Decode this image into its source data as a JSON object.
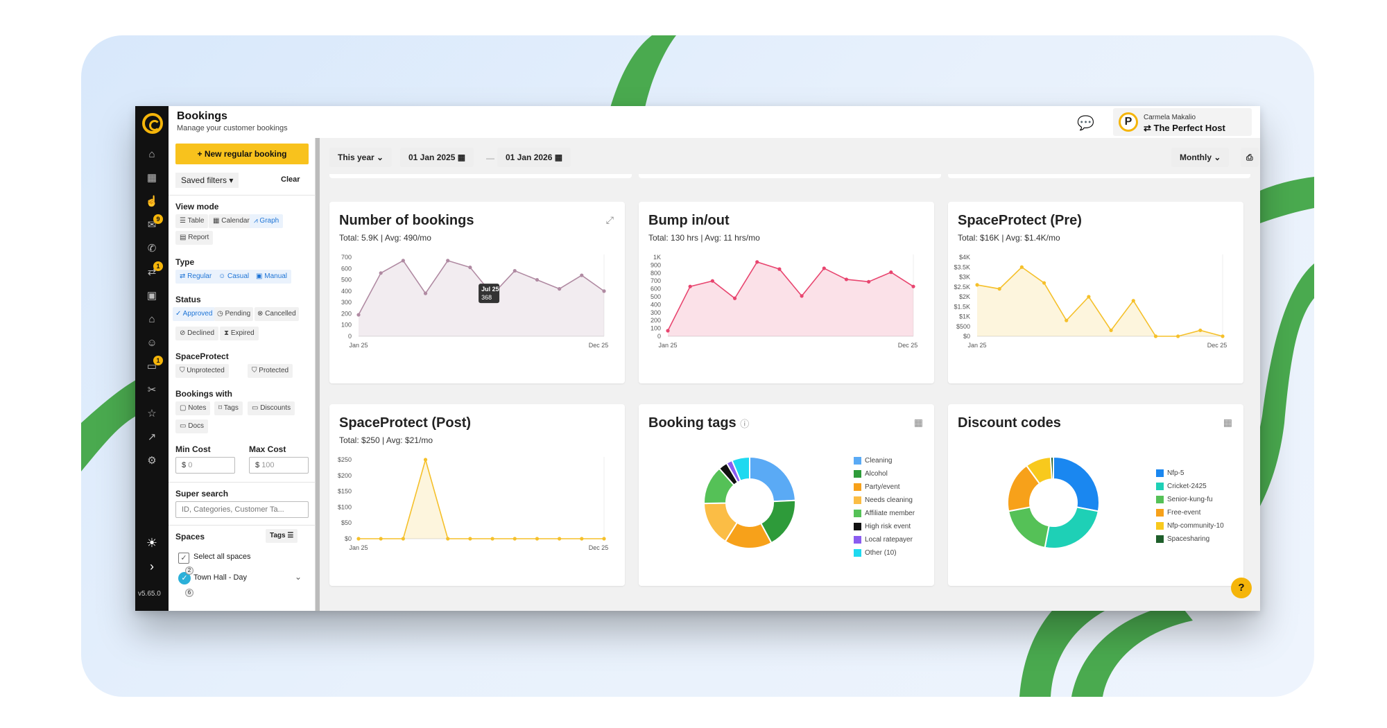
{
  "app": {
    "version": "v5.65.0"
  },
  "header": {
    "title": "Bookings",
    "subtitle": "Manage your customer bookings",
    "user_name": "Carmela Makalio",
    "org": "The Perfect Host",
    "avatar_letter": "P"
  },
  "sidebar": {
    "badges": [
      "9",
      "1",
      "1"
    ]
  },
  "filters": {
    "new_booking": "New regular booking",
    "saved_filters": "Saved filters",
    "clear": "Clear",
    "view_mode": {
      "label": "View mode",
      "options": [
        "Table",
        "Calendar",
        "Graph",
        "Report"
      ]
    },
    "type": {
      "label": "Type",
      "options": [
        "Regular",
        "Casual",
        "Manual"
      ]
    },
    "status": {
      "label": "Status",
      "options": [
        "Approved",
        "Pending",
        "Cancelled",
        "Declined",
        "Expired"
      ]
    },
    "spaceprotect": {
      "label": "SpaceProtect",
      "options": [
        "Unprotected",
        "Protected"
      ]
    },
    "bookings_with": {
      "label": "Bookings with",
      "options": [
        "Notes",
        "Tags",
        "Discounts",
        "Docs"
      ]
    },
    "min_cost": {
      "label": "Min Cost",
      "value": "0"
    },
    "max_cost": {
      "label": "Max Cost",
      "value": "100"
    },
    "currency": "$",
    "super_search": {
      "label": "Super search",
      "placeholder": "ID, Categories, Customer Ta..."
    },
    "spaces": {
      "label": "Spaces",
      "tags": "Tags",
      "select_all": "Select all spaces",
      "items": [
        {
          "name": "Town Hall - Day",
          "count": "2"
        },
        {
          "count": "6"
        }
      ]
    }
  },
  "toolbar": {
    "period": "This year",
    "date_from": "01 Jan 2025",
    "date_to": "01 Jan 2026",
    "interval": "Monthly"
  },
  "colors": {
    "accent": "#f8c21d",
    "link": "#1e74d6"
  },
  "chart_data": [
    {
      "type": "area",
      "title": "Number of bookings",
      "subtitle": "Total: 5.9K | Avg: 490/mo",
      "x": [
        "Jan 25",
        "Feb 25",
        "Mar 25",
        "Apr 25",
        "May 25",
        "Jun 25",
        "Jul 25",
        "Aug 25",
        "Sep 25",
        "Oct 25",
        "Nov 25",
        "Dec 25"
      ],
      "series": [
        {
          "values": [
            190,
            560,
            670,
            380,
            670,
            610,
            368,
            580,
            500,
            420,
            540,
            400
          ],
          "color": "#b08aa2"
        }
      ],
      "y_ticks": [
        "0",
        "100",
        "200",
        "300",
        "400",
        "500",
        "600",
        "700"
      ],
      "ylim": [
        0,
        700
      ],
      "x_tick_labels": [
        "Jan 25",
        "Dec 25"
      ],
      "tooltip": {
        "label": "Jul 25",
        "value": "368"
      }
    },
    {
      "type": "area",
      "title": "Bump in/out",
      "subtitle": "Total: 130 hrs | Avg: 11 hrs/mo",
      "x": [
        "Jan 25",
        "Feb 25",
        "Mar 25",
        "Apr 25",
        "May 25",
        "Jun 25",
        "Jul 25",
        "Aug 25",
        "Sep 25",
        "Oct 25",
        "Nov 25",
        "Dec 25"
      ],
      "series": [
        {
          "values": [
            70,
            630,
            700,
            480,
            940,
            850,
            510,
            860,
            720,
            690,
            810,
            630
          ],
          "color": "#e8456f"
        }
      ],
      "y_ticks": [
        "0",
        "100",
        "200",
        "300",
        "400",
        "500",
        "600",
        "700",
        "800",
        "900",
        "1K"
      ],
      "ylim": [
        0,
        1000
      ],
      "x_tick_labels": [
        "Jan 25",
        "Dec 25"
      ]
    },
    {
      "type": "area",
      "title": "SpaceProtect (Pre)",
      "subtitle": "Total: $16K | Avg: $1.4K/mo",
      "x": [
        "Jan 25",
        "Feb 25",
        "Mar 25",
        "Apr 25",
        "May 25",
        "Jun 25",
        "Jul 25",
        "Aug 25",
        "Sep 25",
        "Oct 25",
        "Nov 25",
        "Dec 25"
      ],
      "series": [
        {
          "values": [
            2600,
            2400,
            3500,
            2700,
            800,
            2000,
            300,
            1800,
            0,
            0,
            300,
            0
          ],
          "color": "#f5c02a"
        }
      ],
      "y_ticks": [
        "$0",
        "$500",
        "$1K",
        "$1.5K",
        "$2K",
        "$2.5K",
        "$3K",
        "$3.5K",
        "$4K"
      ],
      "ylim": [
        0,
        4000
      ],
      "x_tick_labels": [
        "Jan 25",
        "Dec 25"
      ]
    },
    {
      "type": "area",
      "title": "SpaceProtect (Post)",
      "subtitle": "Total: $250 | Avg: $21/mo",
      "x": [
        "Jan 25",
        "Feb 25",
        "Mar 25",
        "Apr 25",
        "May 25",
        "Jun 25",
        "Jul 25",
        "Aug 25",
        "Sep 25",
        "Oct 25",
        "Nov 25",
        "Dec 25"
      ],
      "series": [
        {
          "values": [
            0,
            0,
            0,
            250,
            0,
            0,
            0,
            0,
            0,
            0,
            0,
            0
          ],
          "color": "#f5c02a"
        }
      ],
      "y_ticks": [
        "$0",
        "$50",
        "$100",
        "$150",
        "$200",
        "$250"
      ],
      "ylim": [
        0,
        250
      ],
      "x_tick_labels": [
        "Jan 25",
        "Dec 25"
      ]
    },
    {
      "type": "pie",
      "title": "Booking tags",
      "slices": [
        {
          "label": "Cleaning",
          "value": 23,
          "color": "#5aaaf5"
        },
        {
          "label": "Alcohol",
          "value": 17,
          "color": "#2e9b3a"
        },
        {
          "label": "Party/event",
          "value": 16,
          "color": "#f7a11a"
        },
        {
          "label": "Needs cleaning",
          "value": 15,
          "color": "#fbbd45"
        },
        {
          "label": "Affiliate member",
          "value": 13,
          "color": "#55c157"
        },
        {
          "label": "High risk event",
          "value": 3,
          "color": "#111111"
        },
        {
          "label": "Local ratepayer",
          "value": 2,
          "color": "#8a5cf0"
        },
        {
          "label": "Other (10)",
          "value": 6,
          "color": "#1ed9f0"
        }
      ]
    },
    {
      "type": "pie",
      "title": "Discount codes",
      "slices": [
        {
          "label": "Nfp-5",
          "value": 28,
          "color": "#1a87f0"
        },
        {
          "label": "Cricket-2425",
          "value": 25,
          "color": "#1ed0b6"
        },
        {
          "label": "Senior-kung-fu",
          "value": 19,
          "color": "#55c157"
        },
        {
          "label": "Free-event",
          "value": 18,
          "color": "#f7a11a"
        },
        {
          "label": "Nfp-community-10",
          "value": 9,
          "color": "#f8c91d"
        },
        {
          "label": "Spacesharing",
          "value": 1,
          "color": "#1e5e2a"
        }
      ]
    }
  ]
}
